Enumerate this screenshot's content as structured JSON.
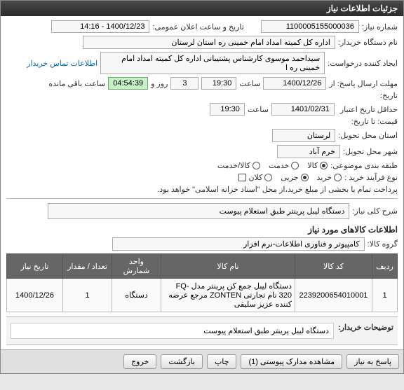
{
  "panel_title": "جزئیات اطلاعات نیاز",
  "labels": {
    "need_no": "شماره نیاز:",
    "announce_dt": "تاریخ و ساعت اعلان عمومی:",
    "buyer_org": "نام دستگاه خریدار:",
    "requester": "ایجاد کننده درخواست:",
    "contact_link": "اطلاعات تماس خریدار",
    "deadline_from": "مهلت ارسال پاسخ: از",
    "to": "تاریخ:",
    "price_valid_to": "حداقل تاریخ اعتبار",
    "price_valid_to2": "قیمت: تا تاریخ:",
    "time": "ساعت",
    "days_and": "روز و",
    "time_left": "ساعت باقی مانده",
    "loc_province": "استان محل تحویل:",
    "loc_city": "شهر محل تحویل:",
    "category": "طبقه بندی موضوعی:",
    "buy_process": "نوع فرآیند خرید :",
    "pay_note": "پرداخت تمام یا بخشی از مبلغ خرید،از محل \"اسناد خزانه اسلامی\" خواهد بود.",
    "need_title": "شرح کلی نیاز:",
    "items_heading": "اطلاعات کالاهای مورد نیاز",
    "goods_group": "گروه کالا:",
    "buyer_notes": "توضیحات خریدار:"
  },
  "values": {
    "need_no": "1100005155000036",
    "announce_dt": "1400/12/23 - 14:16",
    "buyer_org": "اداره کل کمیته امداد امام خمینی  ره  استان لرستان",
    "requester": "سیداحمد موسوی کارشناس پشتیبانی اداره کل کمیته امداد امام خمینی  ره  ا",
    "deadline_date": "1400/12/26",
    "deadline_time": "19:30",
    "days_left": "3",
    "countdown": "04:54:39",
    "price_valid_date": "1401/02/31",
    "price_valid_time": "19:30",
    "province": "لرستان",
    "city": "خرم آباد",
    "need_title": "دستگاه لیبل پرینتر طبق استعلام پیوست",
    "goods_group": "کامپیوتر و فناوری اطلاعات-نرم افزار",
    "buyer_notes": "دستگاه لیبل پرینتر طبق استعلام پیوست"
  },
  "radios": {
    "category": {
      "options": [
        "کالا",
        "خدمت",
        "کالا/خدمت"
      ],
      "selected": 0
    },
    "buy_process": {
      "options": [
        "خرید",
        "جزیی",
        "کلان"
      ],
      "selected": 1
    }
  },
  "table": {
    "headers": [
      "ردیف",
      "کد کالا",
      "نام کالا",
      "واحد شمارش",
      "تعداد / مقدار",
      "تاریخ نیاز"
    ],
    "rows": [
      {
        "idx": "1",
        "code": "2239200654010001",
        "name": "دستگاه لیبل جمع کن پرینتر مدل FQ-320 نام تجارتی ZONTEN مرجع عرضه کننده عزیز سلیقی",
        "unit": "دستگاه",
        "qty": "1",
        "date": "1400/12/26"
      }
    ]
  },
  "buttons": {
    "reply": "پاسخ به نیاز",
    "attachments": "مشاهده مدارک پیوستی (1)",
    "print": "چاپ",
    "back": "بازگشت",
    "exit": "خروج"
  }
}
